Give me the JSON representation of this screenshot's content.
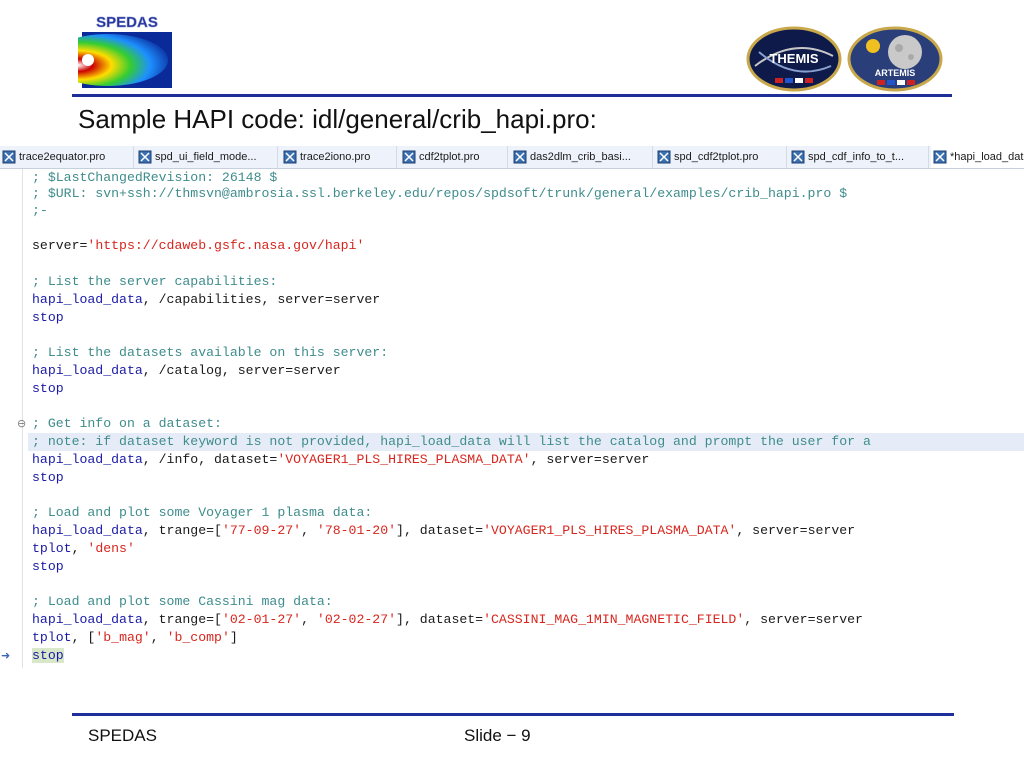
{
  "header": {
    "spedas_logo_text": "SPEDAS",
    "themis_logo_text": "THEMIS",
    "artemis_logo_text": "ARTEMIS",
    "title": "Sample HAPI code: idl/general/crib_hapi.pro:"
  },
  "tabs": [
    {
      "label": "trace2equator.pro",
      "icon": "idl-file-icon"
    },
    {
      "label": "spd_ui_field_mode...",
      "icon": "idl-file-icon"
    },
    {
      "label": "trace2iono.pro",
      "icon": "idl-file-icon"
    },
    {
      "label": "cdf2tplot.pro",
      "icon": "idl-file-icon"
    },
    {
      "label": "das2dlm_crib_basi...",
      "icon": "idl-file-icon"
    },
    {
      "label": "spd_cdf2tplot.pro",
      "icon": "idl-file-icon"
    },
    {
      "label": "spd_cdf_info_to_t...",
      "icon": "idl-file-icon"
    },
    {
      "label": "*hapi_load_dat",
      "icon": "idl-file-icon"
    }
  ],
  "code": {
    "line01": "; $LastChangedRevision: 26148 $",
    "line02": "; $URL: svn+ssh://thmsvn@ambrosia.ssl.berkeley.edu/repos/spdsoft/trunk/general/examples/crib_hapi.pro $",
    "line03": ";-",
    "server_var": "server=",
    "server_url": "'https://cdaweb.gsfc.nasa.gov/hapi'",
    "c_capabilities": "; List the server capabilities:",
    "proc": "hapi_load_data",
    "args_capabilities": ", /capabilities, server=server",
    "stop": "stop",
    "c_catalog": "; List the datasets available on this server:",
    "args_catalog": ", /catalog, server=server",
    "c_info": "; Get info on a dataset:",
    "c_note": "; note: if dataset keyword is not provided, hapi_load_data will list the catalog and prompt the user for a",
    "args_info_a": ", /info, dataset=",
    "voyager_ds": "'VOYAGER1_PLS_HIRES_PLASMA_DATA'",
    "args_server_end": ", server=server",
    "c_voyager": "; Load and plot some Voyager 1 plasma data:",
    "trange_kw": ", trange=[",
    "v_t1": "'77-09-27'",
    "comma": ", ",
    "v_t2": "'78-01-20'",
    "dataset_kw": "], dataset=",
    "tplot": "tplot",
    "dens": "'dens'",
    "c_cassini": "; Load and plot some Cassini mag data:",
    "c_t1": "'02-01-27'",
    "c_t2": "'02-02-27'",
    "cassini_ds": "'CASSINI_MAG_1MIN_MAGNETIC_FIELD'",
    "tplot_open": ", [",
    "b_mag": "'b_mag'",
    "b_comp": "'b_comp'",
    "tplot_close": "]"
  },
  "footer": {
    "left": "SPEDAS",
    "right": "Slide − 9"
  },
  "colors": {
    "rule": "#1f2f9a",
    "comment": "#3f8c8c",
    "keyword": "#1a1aa6",
    "string": "#d7261e",
    "highlight": "#e6ecf7"
  }
}
